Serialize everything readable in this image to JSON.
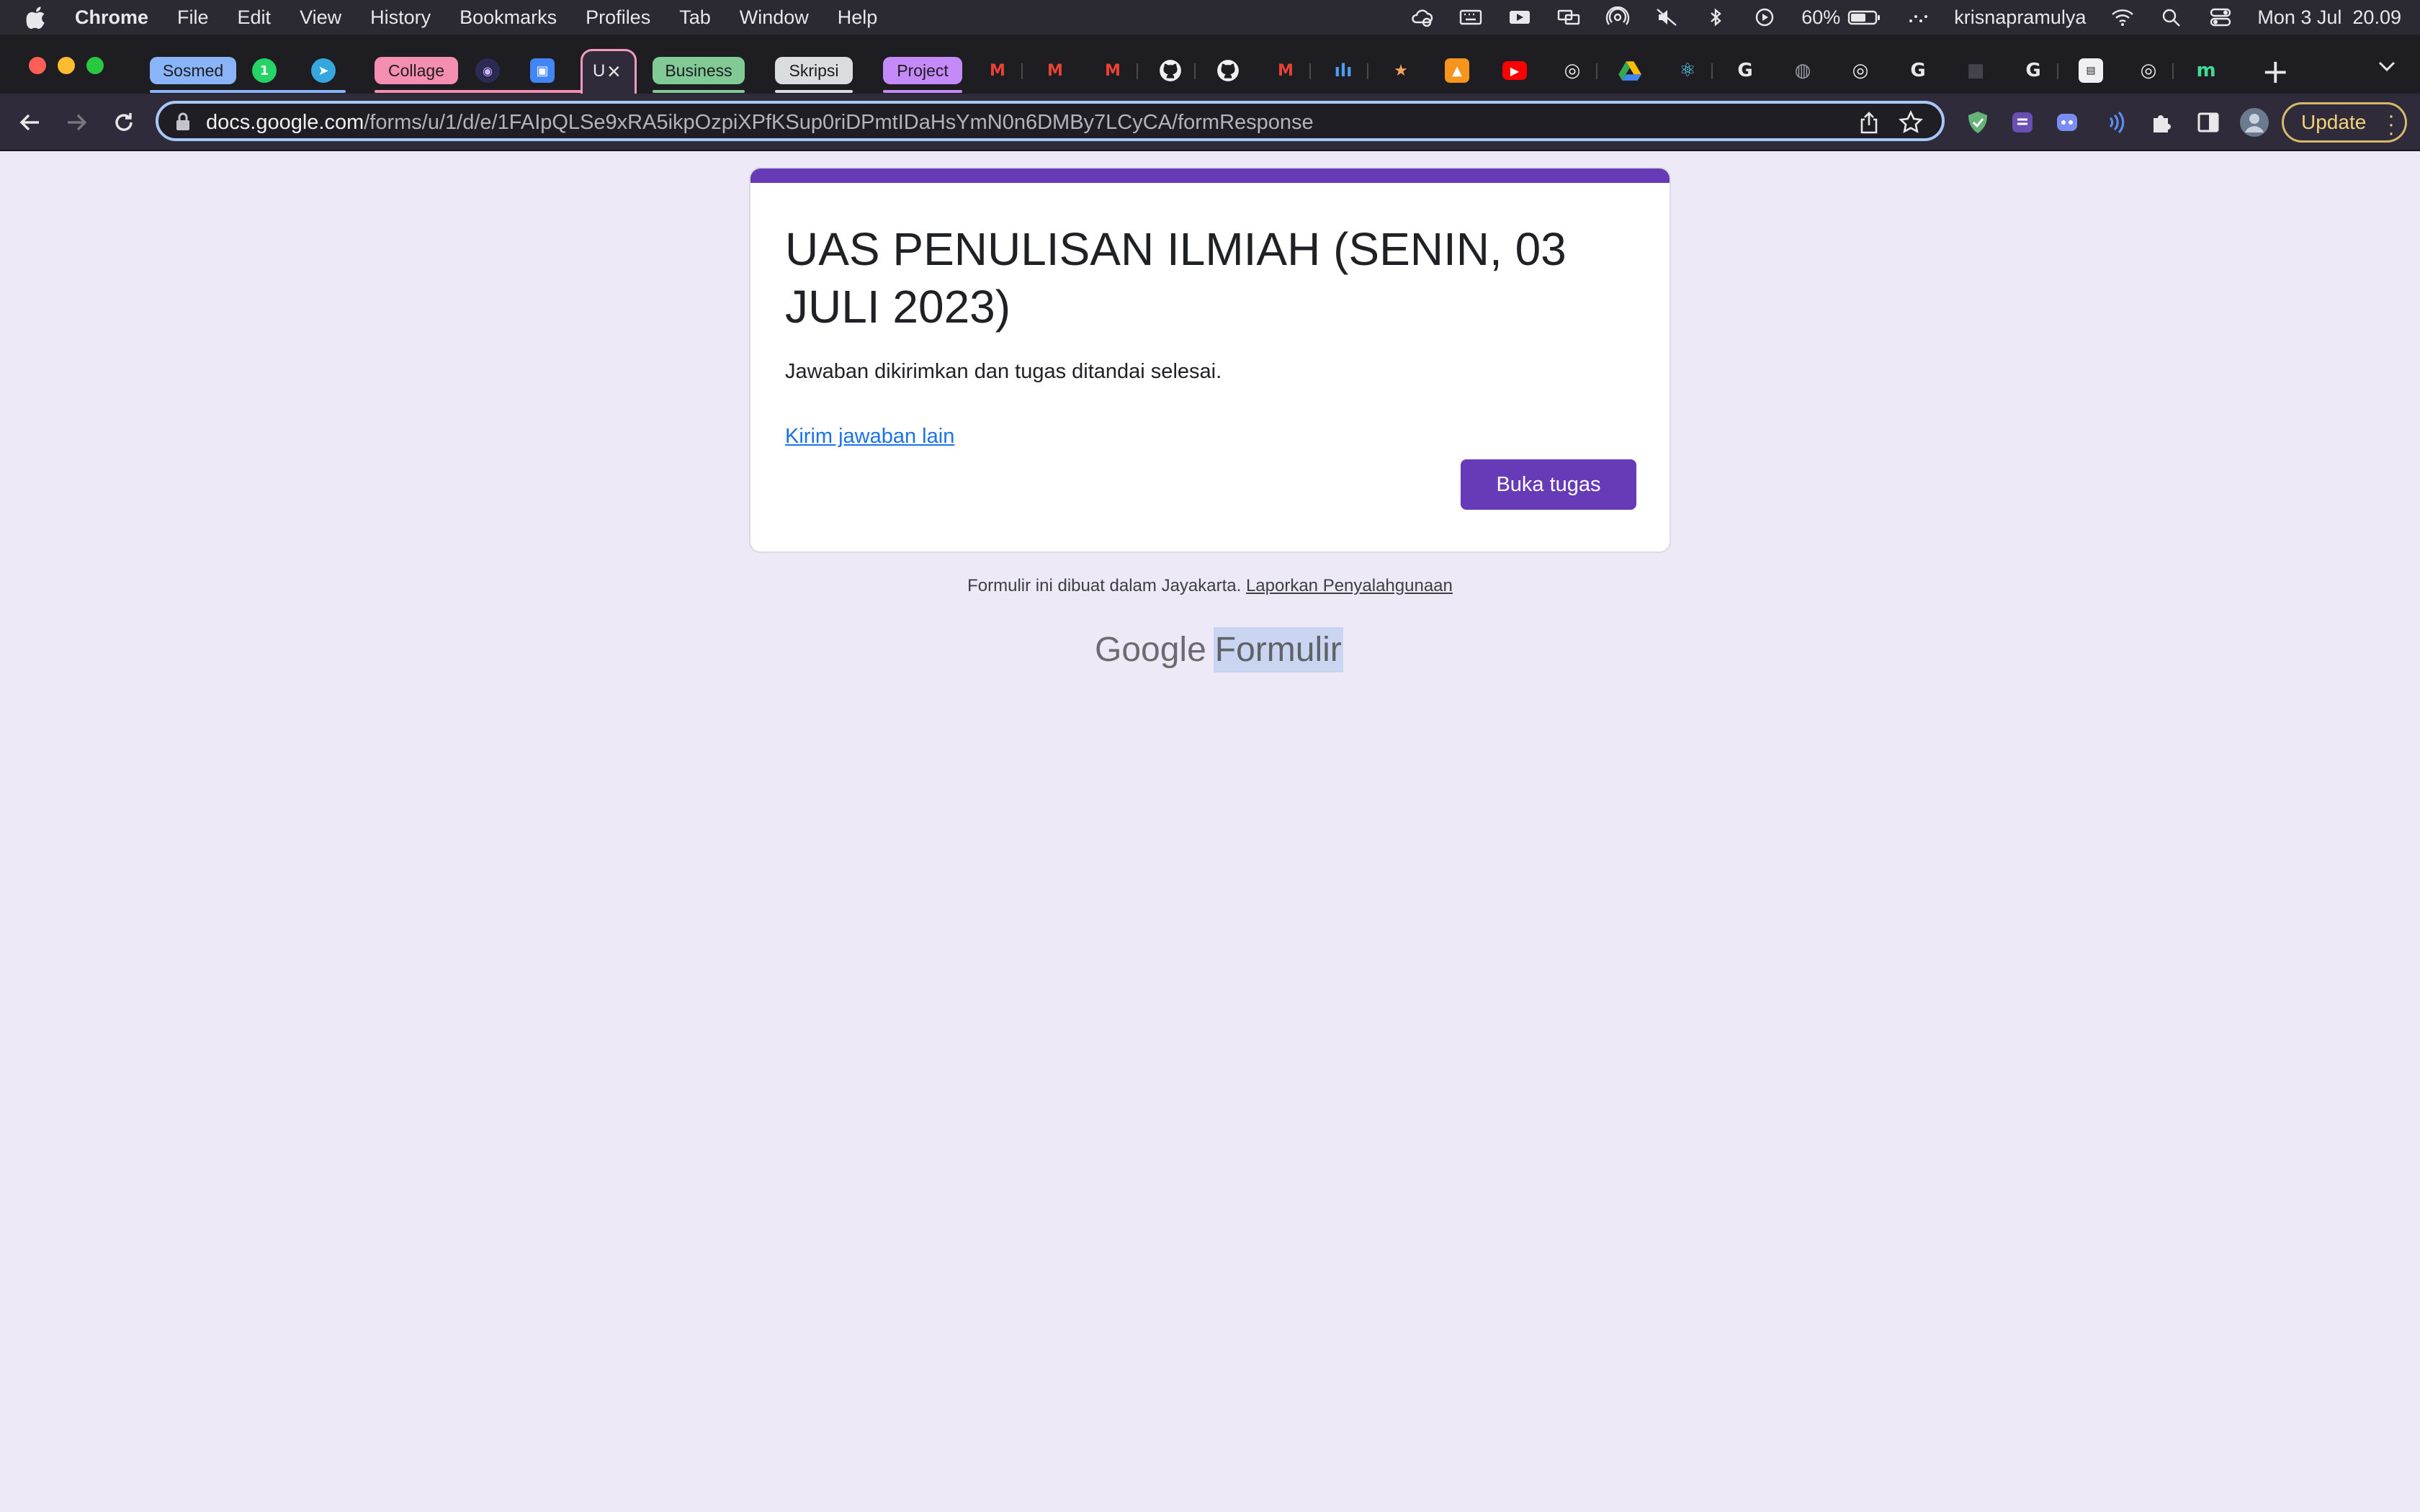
{
  "menubar": {
    "app": "Chrome",
    "items": [
      "File",
      "Edit",
      "View",
      "History",
      "Bookmarks",
      "Profiles",
      "Tab",
      "Window",
      "Help"
    ],
    "battery": "60%",
    "user": "krisnapramulya",
    "datetime": "Mon 3 Jul  20.09"
  },
  "tabs": {
    "groups": [
      {
        "label": "Sosmed",
        "color": "#8ab4f8"
      },
      {
        "label": "Collage",
        "color": "#f48fb1"
      },
      {
        "label": "Business",
        "color": "#81c995"
      },
      {
        "label": "Skripsi",
        "color": "#dadce0"
      },
      {
        "label": "Project",
        "color": "#c58af9"
      }
    ],
    "active_tab_title": "U",
    "whatsapp_badge": "1",
    "new_tab": "+"
  },
  "toolbar": {
    "url_host": "docs.google.com",
    "url_path": "/forms/u/1/d/e/1FAIpQLSe9xRA5ikpOzpiXPfKSup0riDPmtIDaHsYmN0n6DMBy7LCyCA/formResponse",
    "update_label": "Update"
  },
  "form": {
    "accent_color": "#673ab7",
    "title": "UAS PENULISAN ILMIAH (SENIN, 03 JULI 2023)",
    "message": "Jawaban dikirimkan dan tugas ditandai selesai.",
    "resubmit_link": "Kirim jawaban lain",
    "open_task_button": "Buka tugas"
  },
  "footer": {
    "note": "Formulir ini dibuat dalam Jayakarta.",
    "report_link": "Laporkan Penyalahgunaan",
    "brand_google": "Google",
    "brand_product": "Formulir"
  }
}
